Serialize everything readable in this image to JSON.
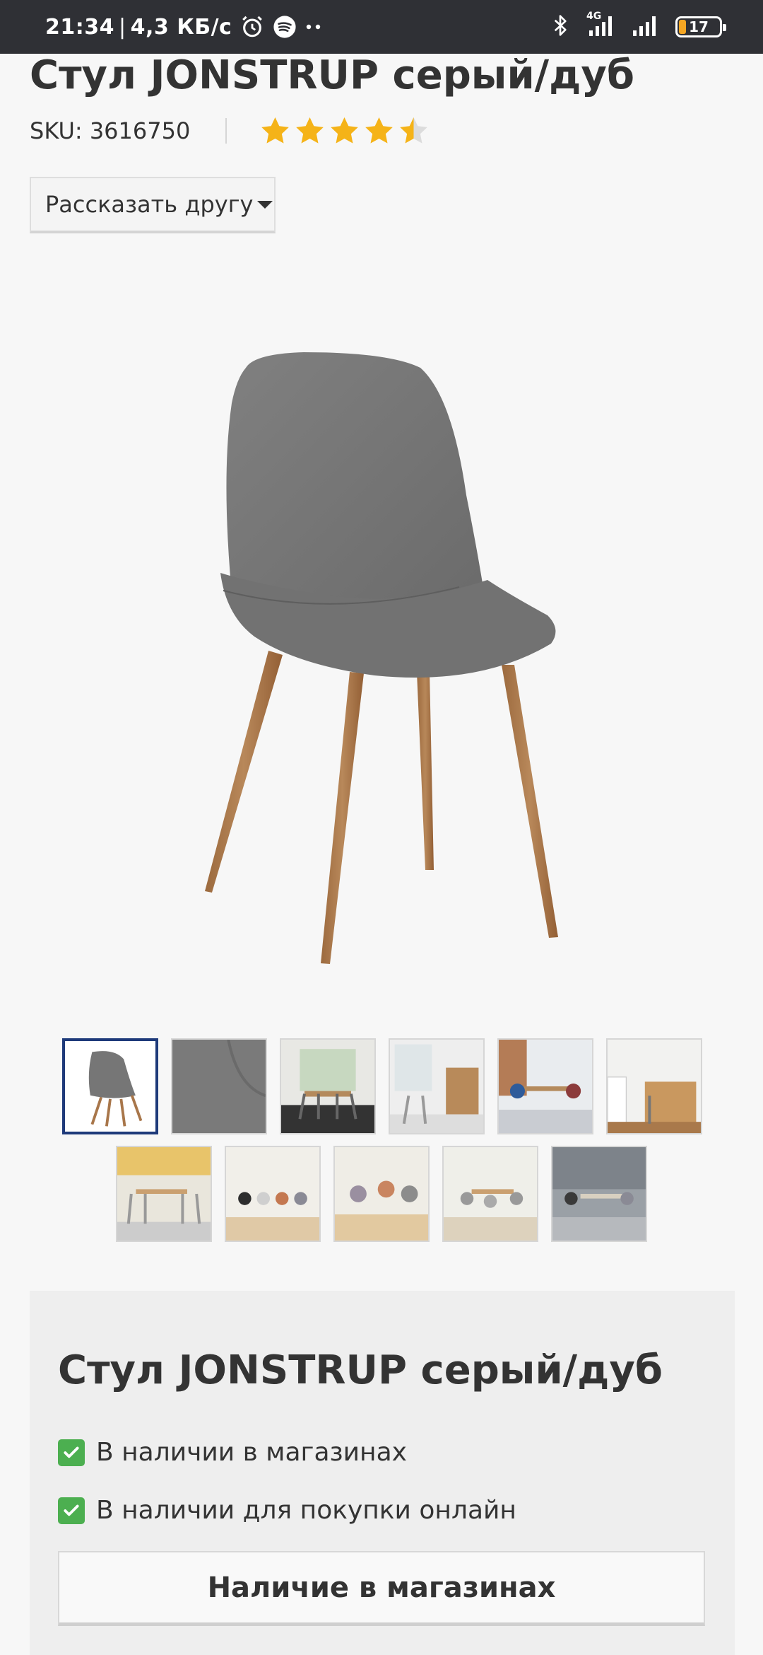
{
  "status_bar": {
    "time": "21:34",
    "network_speed": "4,3 КБ/с",
    "network_type": "4G",
    "battery": "17",
    "icons": [
      "alarm-icon",
      "spotify-icon",
      "more-dots-icon",
      "bluetooth-icon",
      "signal-icon",
      "battery-icon"
    ]
  },
  "product": {
    "title": "Стул JONSTRUP серый/дуб",
    "sku_label": "SKU: 3616750",
    "rating": 4.5,
    "rating_max": 5,
    "share_label": "Рассказать другу"
  },
  "gallery": {
    "active_index": 0,
    "thumbnail_count": 11
  },
  "info_box": {
    "title": "Стул JONSTRUP серый/дуб",
    "in_store": "В наличии в магазинах",
    "online": "В наличии для покупки онлайн",
    "store_button": "Наличие в магазинах"
  },
  "colors": {
    "star": "#f5b318",
    "star_empty": "#dcdcdc",
    "check": "#4caf50",
    "active_thumb_border": "#1e3a7a",
    "chair_fabric": "#767676",
    "chair_legs": "#a8764a"
  }
}
